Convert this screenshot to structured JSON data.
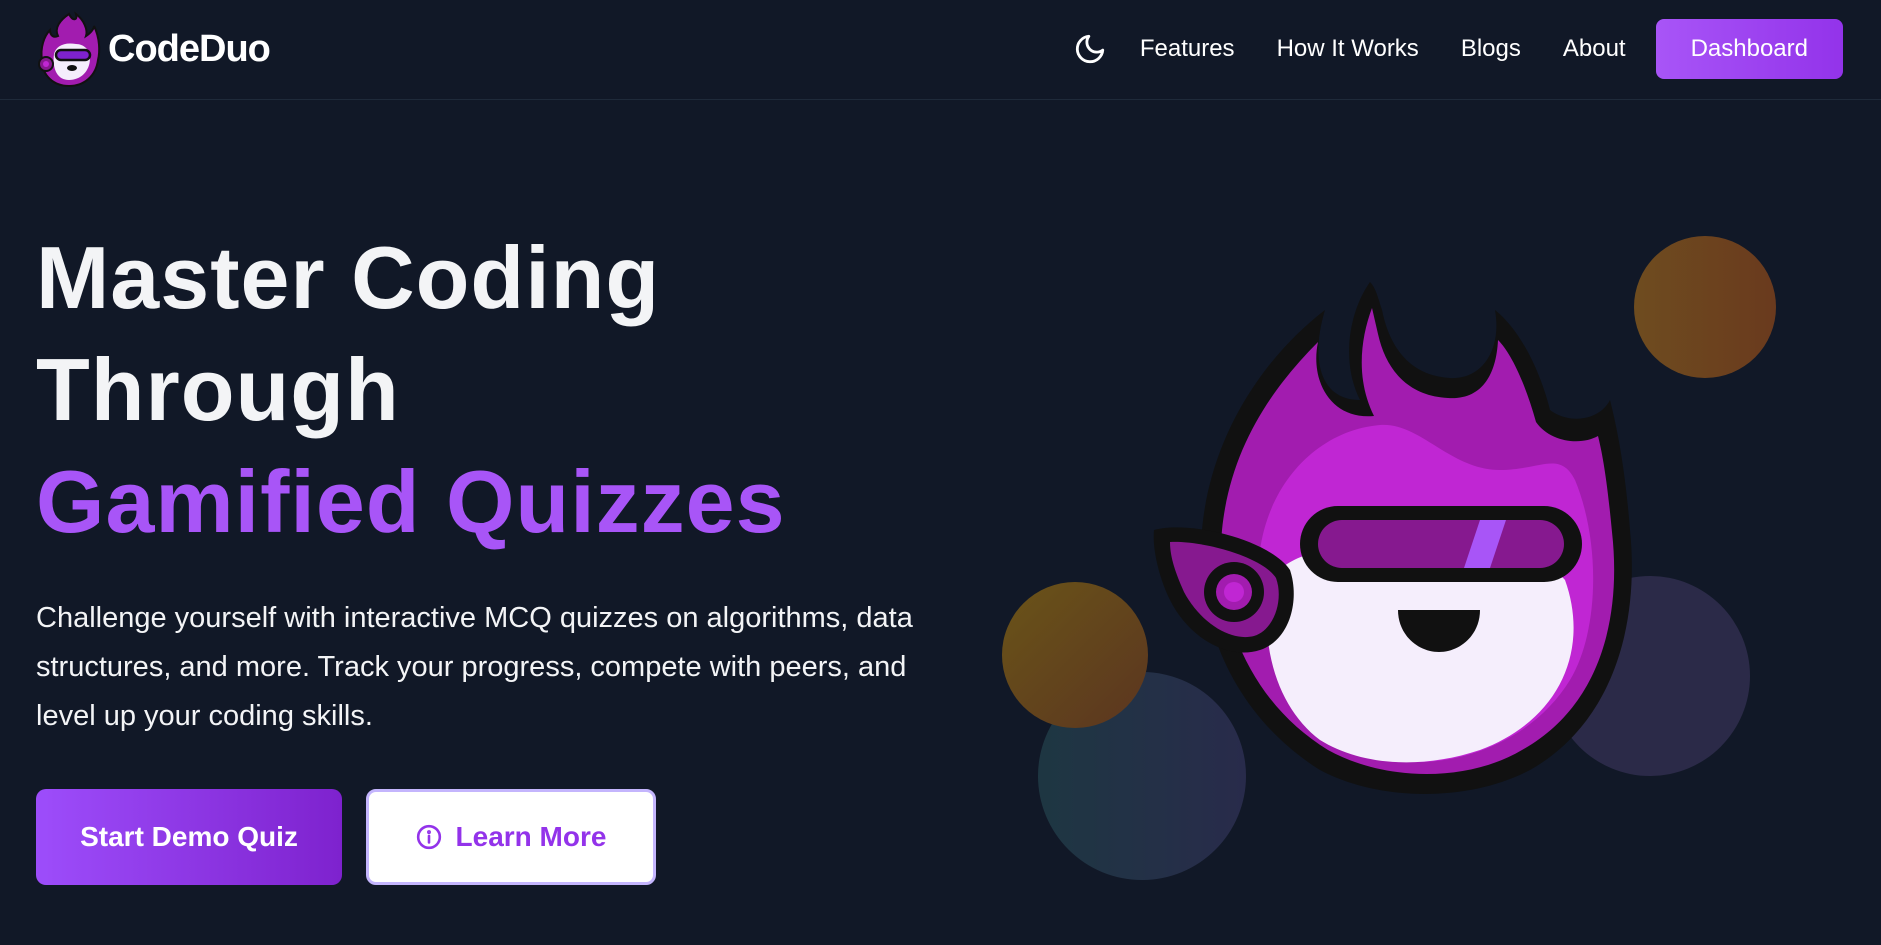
{
  "brand": {
    "name": "CodeDuo",
    "logo": "codeduo-mascot-logo"
  },
  "nav": {
    "theme_icon": "moon-icon",
    "links": [
      {
        "label": "Features"
      },
      {
        "label": "How It Works"
      },
      {
        "label": "Blogs"
      },
      {
        "label": "About"
      }
    ],
    "dashboard_label": "Dashboard"
  },
  "hero": {
    "title_line1": "Master Coding",
    "title_line2": "Through",
    "title_highlight": "Gamified Quizzes",
    "subtitle": "Challenge yourself with interactive MCQ quizzes on algorithms, data structures, and more. Track your progress, compete with peers, and level up your coding skills.",
    "primary_cta": "Start Demo Quiz",
    "secondary_cta": "Learn More",
    "secondary_icon": "info-icon"
  },
  "illustration": {
    "name": "flame-mascot"
  },
  "colors": {
    "background": "#111827",
    "accent": "#a855f7",
    "accent_dark": "#9333ea",
    "text": "#f3f4f6"
  }
}
